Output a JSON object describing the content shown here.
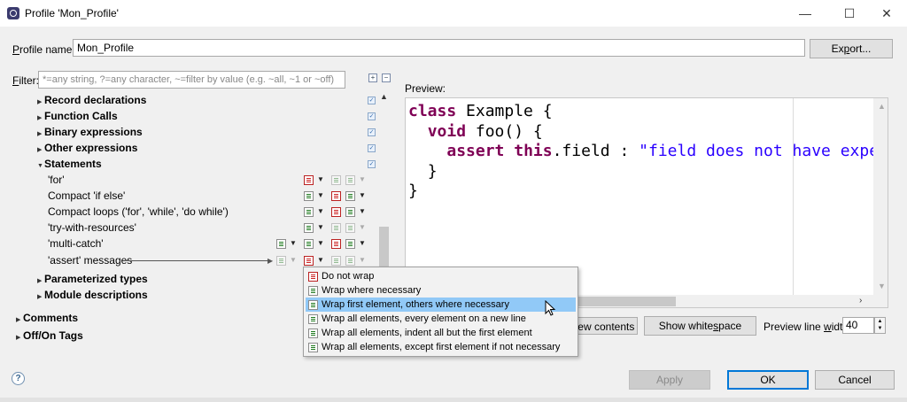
{
  "window": {
    "title": "Profile 'Mon_Profile'",
    "minimize": "—",
    "maximize": "☐",
    "close": "✕"
  },
  "profile": {
    "label_prefix": "",
    "label_mnemonic": "P",
    "label_rest": "rofile name:",
    "value": "Mon_Profile",
    "export_prefix": "Ex",
    "export_mnemonic": "p",
    "export_rest": "ort..."
  },
  "filter": {
    "label_mnemonic": "F",
    "label_rest": "ilter:",
    "placeholder": "*=any string, ?=any character, ~=filter by value (e.g. ~all, ~1 or ~off)"
  },
  "tree": {
    "record_declarations": "Record declarations",
    "function_calls": "Function Calls",
    "binary_expressions": "Binary expressions",
    "other_expressions": "Other expressions",
    "statements": "Statements",
    "for": "'for'",
    "compact_if_else": "Compact 'if else'",
    "compact_loops": "Compact loops ('for', 'while', 'do while')",
    "try_with_resources": "'try-with-resources'",
    "multi_catch": "'multi-catch'",
    "assert_messages": "'assert' messages",
    "parameterized_types": "Parameterized types",
    "module_descriptions": "Module descriptions",
    "comments": "Comments",
    "off_on_tags": "Off/On Tags"
  },
  "preview": {
    "label": "Preview:",
    "code": {
      "kw_class": "class",
      "class_name": " Example {",
      "kw_void": "void",
      "method": " foo() {",
      "kw_assert": "assert",
      "kw_this": "this",
      "field": ".field : ",
      "message": "\"field does not have expected value\"",
      "close_method": "}",
      "close_class": "}"
    },
    "view_contents": "view contents",
    "whitespace_prefix": "Show white",
    "whitespace_mnemonic": "s",
    "whitespace_rest": "pace",
    "line_width_prefix": "Preview line ",
    "line_width_mnemonic": "w",
    "line_width_rest": "idth:",
    "line_width_value": "40"
  },
  "wrap_menu": {
    "items": [
      "Do not wrap",
      "Wrap where necessary",
      "Wrap first element, others where necessary",
      "Wrap all elements, every element on a new line",
      "Wrap all elements, indent all but the first element",
      "Wrap all elements, except first element if not necessary"
    ],
    "hovered_index": 2
  },
  "footer": {
    "help": "?",
    "apply": "Apply",
    "ok": "OK",
    "cancel": "Cancel"
  },
  "colors": {
    "keyword": "#7f0055",
    "string": "#2a00ff",
    "menu_hover": "#91c9f7",
    "ok_border": "#0078d7"
  }
}
